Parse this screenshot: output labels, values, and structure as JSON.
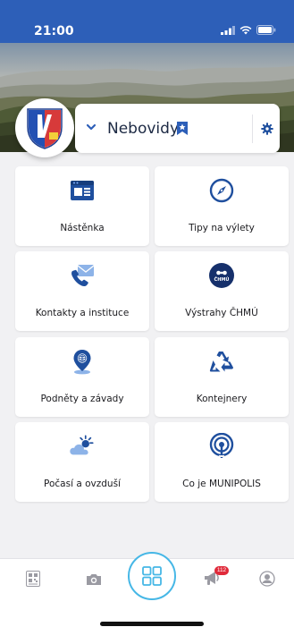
{
  "status_bar": {
    "time": "21:00"
  },
  "header": {
    "village_name": "Nebovidy"
  },
  "tiles": [
    {
      "label": "Nástěnka",
      "icon": "bulletin-board-icon"
    },
    {
      "label": "Tipy na výlety",
      "icon": "compass-icon"
    },
    {
      "label": "Kontakty a instituce",
      "icon": "contacts-phone-icon"
    },
    {
      "label": "Výstrahy ČHMÚ",
      "icon": "chmu-warning-icon",
      "icon_text": "ČHMÚ"
    },
    {
      "label": "Podněty a závady",
      "icon": "location-pin-globe-icon"
    },
    {
      "label": "Kontejnery",
      "icon": "recycle-icon"
    },
    {
      "label": "Počasí a ovzduší",
      "icon": "weather-icon"
    },
    {
      "label": "Co je MUNIPOLIS",
      "icon": "munipolis-broadcast-icon"
    }
  ],
  "tabbar": {
    "items": [
      "qr-code-icon",
      "camera-icon",
      "home-grid-icon",
      "notifications-megaphone-icon",
      "profile-icon"
    ],
    "notification_badge": "112"
  },
  "colors": {
    "primary": "#2d5fb8",
    "icon_blue": "#1f4f9e",
    "accent_cyan": "#46b7e6",
    "badge_red": "#e02a3a"
  }
}
